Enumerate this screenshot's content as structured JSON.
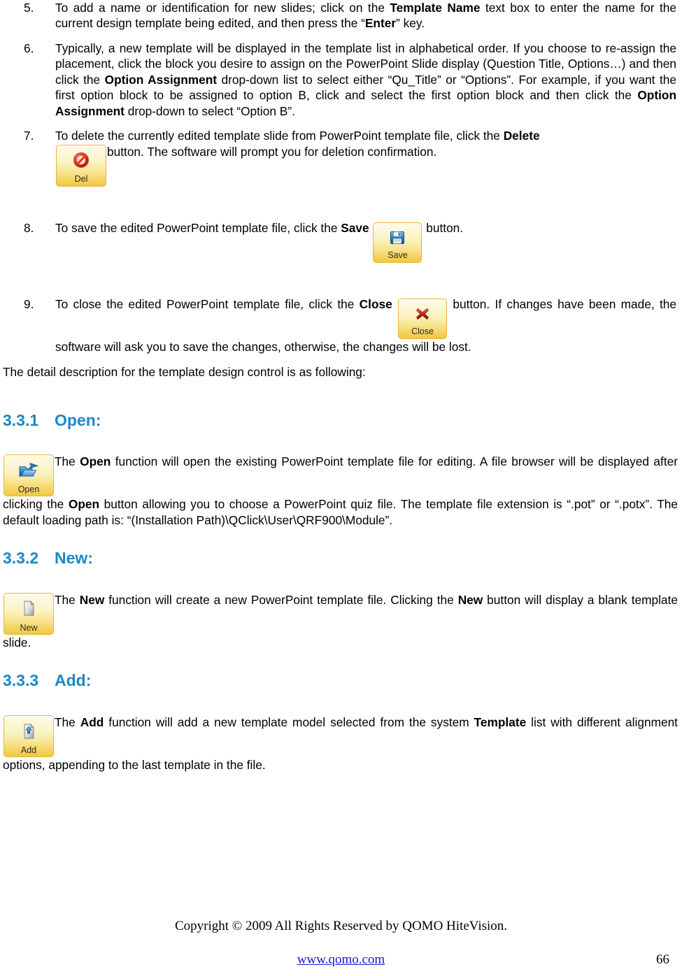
{
  "document": {
    "list_items": [
      {
        "number": "5.",
        "segments": [
          {
            "t": "To add a name or identification for new slides; click on the ",
            "b": false
          },
          {
            "t": "Template Name",
            "b": true
          },
          {
            "t": " text box to enter the name for the current design template being edited, and then press the  “",
            "b": false
          },
          {
            "t": "Enter",
            "b": true
          },
          {
            "t": "” key.",
            "b": false
          }
        ]
      },
      {
        "number": "6.",
        "segments": [
          {
            "t": "Typically, a new template will be displayed in the template list in alphabetical order. If you choose to re-assign the placement, click the block you desire to assign on the PowerPoint Slide display (Question Title, Options…) and then click the ",
            "b": false
          },
          {
            "t": "Option Assignment",
            "b": true
          },
          {
            "t": " drop-down list to select either “Qu_Title” or “Options”. For example, if you want the first option block to be assigned to option B, click and select the first option block and then click the ",
            "b": false
          },
          {
            "t": "Option Assignment",
            "b": true
          },
          {
            "t": " drop-down to select “Option B”.",
            "b": false
          }
        ]
      }
    ],
    "item7": {
      "number": "7.",
      "before": "To delete the currently edited template slide from PowerPoint template file, click the ",
      "bold": "Delete",
      "after": "button. The software will prompt you for deletion confirmation."
    },
    "item8": {
      "number": "8.",
      "before": "To save the edited PowerPoint template file, click the ",
      "bold": "Save",
      "after": " button."
    },
    "item9": {
      "number": "9.",
      "before": "To close the edited PowerPoint template file, click the ",
      "bold": "Close",
      "after": " button. If changes have been made, the software will ask you to save the changes, otherwise, the changes will be lost."
    },
    "detail_line": "The detail description for the template design control is as following:",
    "sections": [
      {
        "number": "3.3.1",
        "title": "Open:",
        "button_label": "Open",
        "button_icon": "open-folder-icon",
        "segments": [
          {
            "t": "The ",
            "b": false
          },
          {
            "t": "Open",
            "b": true
          },
          {
            "t": " function will open the existing PowerPoint template file for editing. A file browser will be displayed after clicking the ",
            "b": false
          },
          {
            "t": "Open",
            "b": true
          },
          {
            "t": " button allowing you to choose a PowerPoint quiz file. The template file extension is “.pot” or “.potx”. The default loading path is: “(Installation Path)\\QClick\\User\\QRF900\\Module”.",
            "b": false
          }
        ]
      },
      {
        "number": "3.3.2",
        "title": "New:",
        "button_label": "New",
        "button_icon": "new-document-icon",
        "segments": [
          {
            "t": "The ",
            "b": false
          },
          {
            "t": "New",
            "b": true
          },
          {
            "t": " function will create a new PowerPoint template file. Clicking the ",
            "b": false
          },
          {
            "t": "New",
            "b": true
          },
          {
            "t": " button will display a blank template slide.",
            "b": false
          }
        ]
      },
      {
        "number": "3.3.3",
        "title": "Add:",
        "button_label": "Add",
        "button_icon": "add-document-icon",
        "segments": [
          {
            "t": "The ",
            "b": false
          },
          {
            "t": "Add",
            "b": true
          },
          {
            "t": " function will add a new template model selected from the system ",
            "b": false
          },
          {
            "t": "Template",
            "b": true
          },
          {
            "t": " list with different alignment options, appending to the last template in the file.",
            "b": false
          }
        ]
      }
    ],
    "buttons": {
      "delete": {
        "label": "Del",
        "icon": "no-entry-icon"
      },
      "save": {
        "label": "Save",
        "icon": "floppy-disk-icon"
      },
      "close": {
        "label": "Close",
        "icon": "red-x-icon"
      }
    },
    "footer": {
      "copyright": "Copyright © 2009 All Rights Reserved by QOMO HiteVision.",
      "url": "www.qomo.com",
      "page_number": "66"
    },
    "colors": {
      "heading_blue": "#1b87c5",
      "link_blue": "#1818d8",
      "button_gold": "#f0c942",
      "button_border": "#e8b53f"
    }
  }
}
